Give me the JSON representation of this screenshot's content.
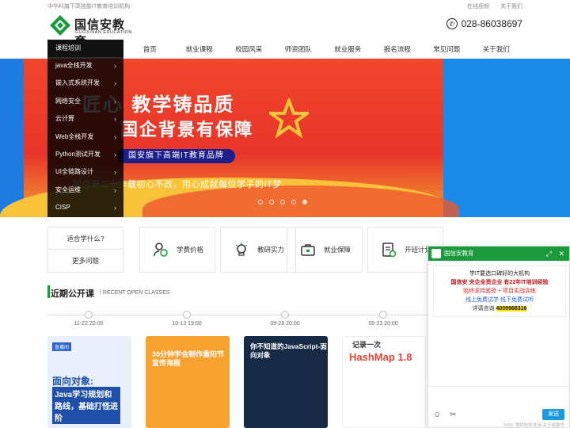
{
  "topbar": {
    "slogan": "中华科旗下高技能IT教育培训机构",
    "links": [
      "在线视频",
      "关于我们"
    ]
  },
  "header": {
    "logo_cn": "国信安教育",
    "logo_en": "GUOXINAN EDUCATION",
    "phone": "028-86038697"
  },
  "nav": {
    "items": [
      "首页",
      "就业课程",
      "校园风采",
      "师资团队",
      "就业服务",
      "报名流程",
      "常见问题",
      "关于我们"
    ]
  },
  "sidemenu": {
    "head": "课程培训",
    "items": [
      "java全栈开发",
      "嵌入式系统开发",
      "网络安全",
      "云计算",
      "Web全栈开发",
      "Python测试开发",
      "UI全链路设计",
      "安全运维",
      "CISP"
    ]
  },
  "banner": {
    "line1": "匠心 教学铸品质",
    "line2": "国企背景有保障",
    "pill": "国安旗下高端IT教育品牌",
    "line3": "国信安二十年载初心不改，用心成就每位学子的IT梦"
  },
  "features": {
    "left": [
      "适合学什么?",
      "更多问题"
    ],
    "cards": [
      {
        "icon": "user-price-icon",
        "label": "学费价格"
      },
      {
        "icon": "bulb-icon",
        "label": "教研实力"
      },
      {
        "icon": "briefcase-icon",
        "label": "就业保障"
      },
      {
        "icon": "plan-icon",
        "label": "开班计划"
      }
    ]
  },
  "recent": {
    "title": "近期公开课",
    "subtitle": "/ RECENT OPEN CLASSES"
  },
  "timeline": [
    "11-22 20:00",
    "10-13 19:00",
    "09-28 20:00",
    "09-23 20:00"
  ],
  "cards": {
    "c1": {
      "tag": "直播间",
      "big": "面向对象:",
      "big2": "Java学习规划和路线，基础打怪进阶"
    },
    "c2": {
      "big": "30分钟学会制作重阳节宣传海报"
    },
    "c3": {
      "big": "你不知道的JavaScript-面向对象"
    },
    "c4": {
      "big": "记录一次",
      "hm": "HashMap 1.8"
    }
  },
  "chat": {
    "title": "国信安教育",
    "r1": "学IT要选口碑好的大机构",
    "r2": "国信安 央企全资企业 有22年IT培训经验",
    "r3": "始终坚持面授 + 项目实战训练",
    "r4": "线上免费试学 线下免费试听",
    "r5_prefix": "详请咨询",
    "r5_num": "4009988316",
    "send": "发送",
    "foot": "53KF 提供软件支持  关于客服号"
  },
  "colors": {
    "brand_green": "#1a9a3a",
    "banner_red": "#e8352a",
    "chat_send": "#1a9ae0"
  }
}
